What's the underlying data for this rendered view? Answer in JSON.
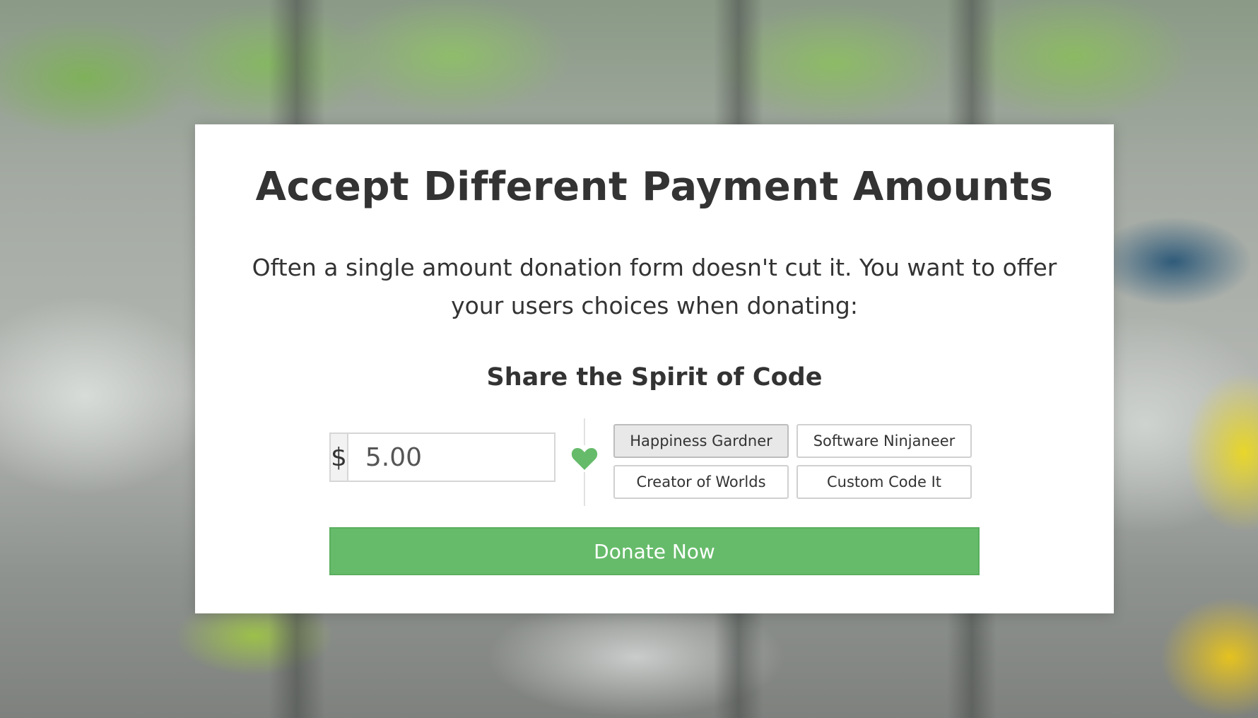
{
  "heading": {
    "title": "Accept Different Payment Amounts",
    "subtitle": "Often a single amount donation form doesn't cut it. You want to offer your users choices when donating:"
  },
  "form": {
    "title": "Share the Spirit of Code",
    "currency_symbol": "$",
    "amount_value": "5.00",
    "heart_icon": "heart-icon",
    "accent_color": "#66bb6a",
    "levels": [
      {
        "label": "Happiness Gardner",
        "selected": true
      },
      {
        "label": "Software Ninjaneer",
        "selected": false
      },
      {
        "label": "Creator of Worlds",
        "selected": false
      },
      {
        "label": "Custom Code It",
        "selected": false
      }
    ],
    "donate_label": "Donate Now"
  }
}
